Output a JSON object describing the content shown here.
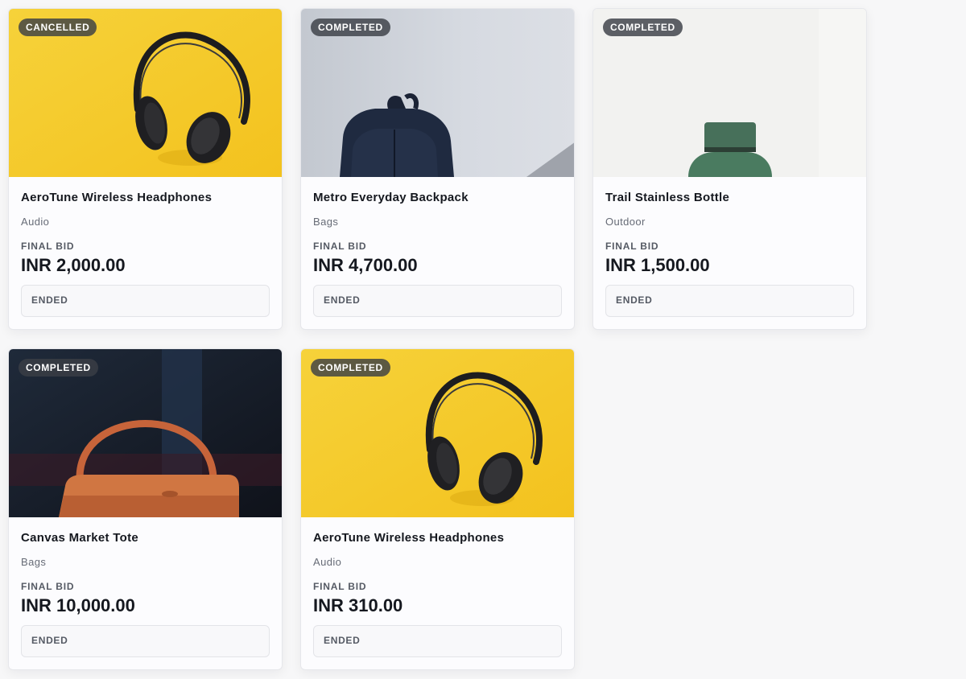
{
  "currency_prefix": "INR",
  "cards": [
    {
      "badge": "CANCELLED",
      "title": "AeroTune Wireless Headphones",
      "category": "Audio",
      "bid_label": "FINAL BID",
      "price": "INR 2,000.00",
      "status": "ENDED",
      "image": "headphones-on-yellow"
    },
    {
      "badge": "COMPLETED",
      "title": "Metro Everyday Backpack",
      "category": "Bags",
      "bid_label": "FINAL BID",
      "price": "INR 4,700.00",
      "status": "ENDED",
      "image": "navy-backpack-on-grey"
    },
    {
      "badge": "COMPLETED",
      "title": "Trail Stainless Bottle",
      "category": "Outdoor",
      "bid_label": "FINAL BID",
      "price": "INR 1,500.00",
      "status": "ENDED",
      "image": "green-bottle-on-white"
    },
    {
      "badge": "COMPLETED",
      "title": "Canvas Market Tote",
      "category": "Bags",
      "bid_label": "FINAL BID",
      "price": "INR 10,000.00",
      "status": "ENDED",
      "image": "orange-handbag-on-dark"
    },
    {
      "badge": "COMPLETED",
      "title": "AeroTune Wireless Headphones",
      "category": "Audio",
      "bid_label": "FINAL BID",
      "price": "INR 310.00",
      "status": "ENDED",
      "image": "headphones-on-yellow"
    }
  ],
  "colors": {
    "badge_bg": "#3a3e46",
    "page_bg": "#f7f7f8",
    "card_bg": "#fcfcfe",
    "text_primary": "#15181f",
    "text_muted": "#666b76"
  }
}
